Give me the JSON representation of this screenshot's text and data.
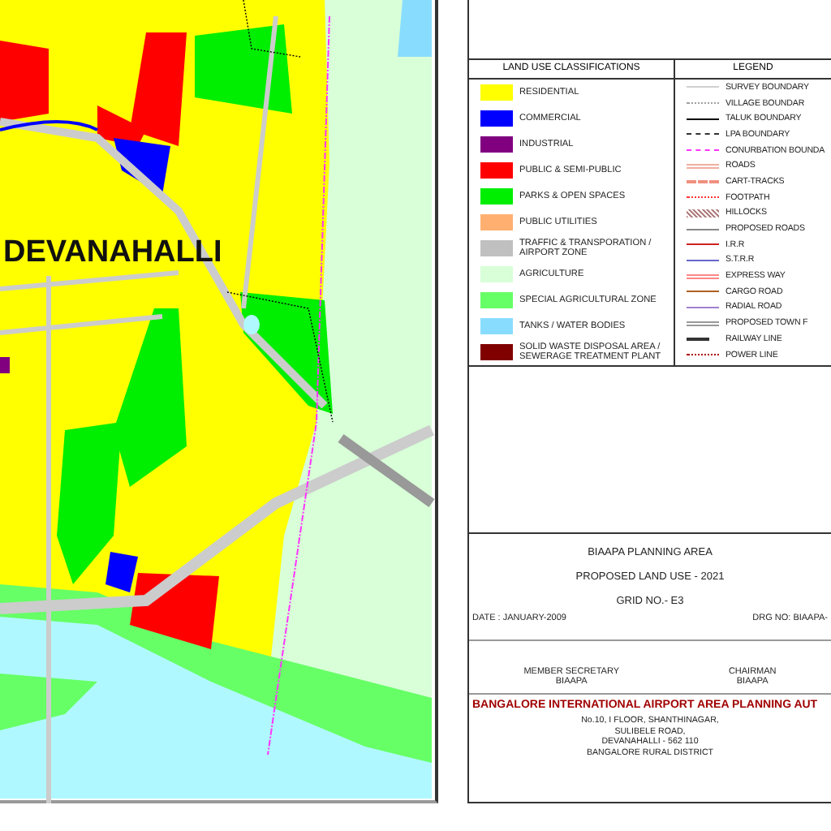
{
  "map": {
    "town_label": "DEVANAHALLI"
  },
  "land_use": {
    "heading": "LAND USE CLASSIFICATIONS",
    "items": [
      {
        "label": "RESIDENTIAL",
        "color": "#ffff00"
      },
      {
        "label": "COMMERCIAL",
        "color": "#0000ff"
      },
      {
        "label": "INDUSTRIAL",
        "color": "#800080"
      },
      {
        "label": "PUBLIC & SEMI-PUBLIC",
        "color": "#ff0000"
      },
      {
        "label": "PARKS & OPEN SPACES",
        "color": "#00ee00"
      },
      {
        "label": "PUBLIC UTILITIES",
        "color": "#ffb070"
      },
      {
        "label": "TRAFFIC & TRANSPORATION / AIRPORT ZONE",
        "color": "#c0c0c0"
      },
      {
        "label": "AGRICULTURE",
        "color": "#d8ffd8"
      },
      {
        "label": "SPECIAL AGRICULTURAL ZONE",
        "color": "#66ff66"
      },
      {
        "label": "TANKS  / WATER BODIES",
        "color": "#88ddff"
      },
      {
        "label": "SOLID WASTE DISPOSAL AREA / SEWERAGE TREATMENT PLANT",
        "color": "#800000"
      }
    ]
  },
  "legend": {
    "heading": "LEGEND",
    "items": [
      {
        "label": "SURVEY BOUNDARY",
        "kind": "solid",
        "color": "#d0d0d0"
      },
      {
        "label": "VILLAGE  BOUNDAR",
        "kind": "dotted",
        "color": "#a0a0a0"
      },
      {
        "label": "TALUK BOUNDARY",
        "kind": "solid",
        "color": "#000000"
      },
      {
        "label": "LPA  BOUNDARY",
        "kind": "dashdot",
        "color": "#333333"
      },
      {
        "label": "CONURBATION BOUNDA",
        "kind": "dashdot",
        "color": "#ff33ff"
      },
      {
        "label": "ROADS",
        "kind": "double",
        "color": "#f0b0a0"
      },
      {
        "label": "CART-TRACKS",
        "kind": "dashed",
        "color": "#f09080"
      },
      {
        "label": "FOOTPATH",
        "kind": "dotted",
        "color": "#ff3333"
      },
      {
        "label": "HILLOCKS",
        "kind": "hatch",
        "color": "#b08080"
      },
      {
        "label": "PROPOSED ROADS",
        "kind": "solid",
        "color": "#888888"
      },
      {
        "label": "I.R.R",
        "kind": "solid",
        "color": "#cc2222"
      },
      {
        "label": "S.T.R.R",
        "kind": "solid",
        "color": "#6666cc"
      },
      {
        "label": "EXPRESS WAY",
        "kind": "double",
        "color": "#ff8888"
      },
      {
        "label": "CARGO ROAD",
        "kind": "solid",
        "color": "#b06020"
      },
      {
        "label": "RADIAL ROAD",
        "kind": "solid",
        "color": "#a080d0"
      },
      {
        "label": "PROPOSED TOWN F",
        "kind": "double",
        "color": "#999999"
      },
      {
        "label": "RAILWAY LINE",
        "kind": "railway",
        "color": "#333333"
      },
      {
        "label": "POWER LINE",
        "kind": "dotted",
        "color": "#aa0000"
      }
    ]
  },
  "title_block": {
    "area": "BIAAPA PLANNING AREA",
    "title": "PROPOSED LAND USE - 2021",
    "grid": "GRID NO.- E3",
    "date": "DATE : JANUARY-2009",
    "drawing_no": "DRG NO: BIAAPA-",
    "signatories": [
      {
        "role": "MEMBER SECRETARY",
        "org": "BIAAPA"
      },
      {
        "role": "CHAIRMAN",
        "org": "BIAAPA"
      }
    ],
    "authority": "BANGALORE INTERNATIONAL AIRPORT AREA PLANNING AUT",
    "address": [
      "No.10, I FLOOR, SHANTHINAGAR,",
      "SULIBELE ROAD,",
      "DEVANAHALLI - 562 110",
      "BANGALORE RURAL DISTRICT"
    ]
  }
}
